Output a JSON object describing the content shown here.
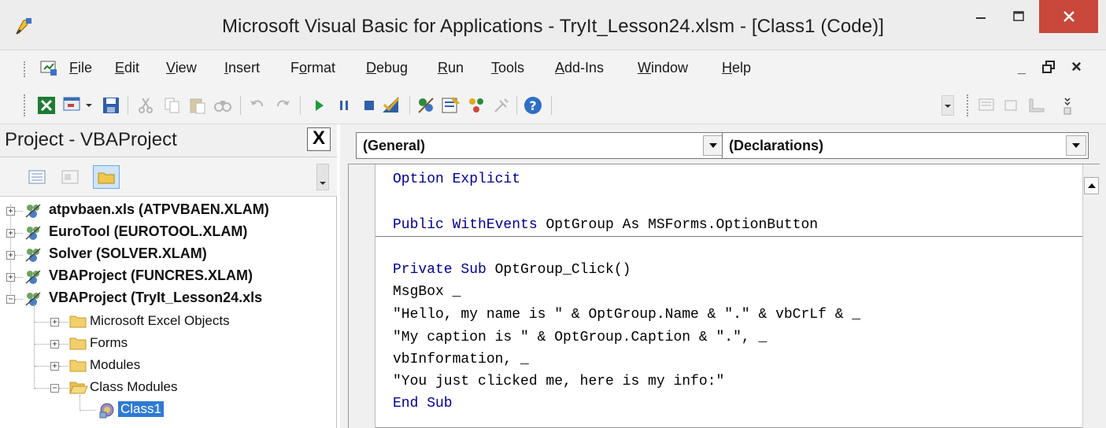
{
  "window": {
    "title": "Microsoft Visual Basic for Applications - TryIt_Lesson24.xlsm - [Class1 (Code)]",
    "close_color": "#c9473b"
  },
  "menu": {
    "items": [
      {
        "label": "File",
        "accel": "F",
        "rest": "ile"
      },
      {
        "label": "Edit",
        "accel": "E",
        "rest": "dit"
      },
      {
        "label": "View",
        "accel": "V",
        "rest": "iew"
      },
      {
        "label": "Insert",
        "accel": "I",
        "rest": "nsert"
      },
      {
        "label": "Format",
        "accel": "o",
        "pre": "F",
        "rest": "rmat"
      },
      {
        "label": "Debug",
        "accel": "D",
        "rest": "ebug"
      },
      {
        "label": "Run",
        "accel": "R",
        "rest": "un"
      },
      {
        "label": "Tools",
        "accel": "T",
        "rest": "ools"
      },
      {
        "label": "Add-Ins",
        "accel": "A",
        "rest": "dd-Ins"
      },
      {
        "label": "Window",
        "accel": "W",
        "rest": "indow"
      },
      {
        "label": "Help",
        "accel": "H",
        "rest": "elp"
      }
    ],
    "mdi_min": "_",
    "mdi_restore": "🗗",
    "mdi_close": "×"
  },
  "project": {
    "title": "Project - VBAProject",
    "close_label": "X",
    "projects": [
      {
        "label": "atpvbaen.xls (ATPVBAEN.XLAM)",
        "expander": "+"
      },
      {
        "label": "EuroTool (EUROTOOL.XLAM)",
        "expander": "+"
      },
      {
        "label": "Solver (SOLVER.XLAM)",
        "expander": "+"
      },
      {
        "label": "VBAProject (FUNCRES.XLAM)",
        "expander": "+"
      },
      {
        "label": "VBAProject (TryIt_Lesson24.xls",
        "expander": "−"
      }
    ],
    "folders": [
      {
        "label": "Microsoft Excel Objects",
        "expander": "+"
      },
      {
        "label": "Forms",
        "expander": "+"
      },
      {
        "label": "Modules",
        "expander": "+"
      },
      {
        "label": "Class Modules",
        "expander": "−"
      }
    ],
    "selected_item": "Class1"
  },
  "code": {
    "object_combo": "(General)",
    "procedure_combo": "(Declarations)",
    "lines": {
      "l1_kw": "Option Explicit",
      "l2_kw": "Public WithEvents",
      "l2_rest": " OptGroup As MSForms.OptionButton",
      "l3_kw": "Private Sub",
      "l3_rest": " OptGroup_Click()",
      "l4": "MsgBox _",
      "l5": "\"Hello, my name is \" & OptGroup.Name & \".\" & vbCrLf & _",
      "l6": "\"My caption is \" & OptGroup.Caption & \".\", _",
      "l7": "vbInformation, _",
      "l8": "\"You just clicked me, here is my info:\"",
      "l9_kw": "End Sub"
    }
  }
}
